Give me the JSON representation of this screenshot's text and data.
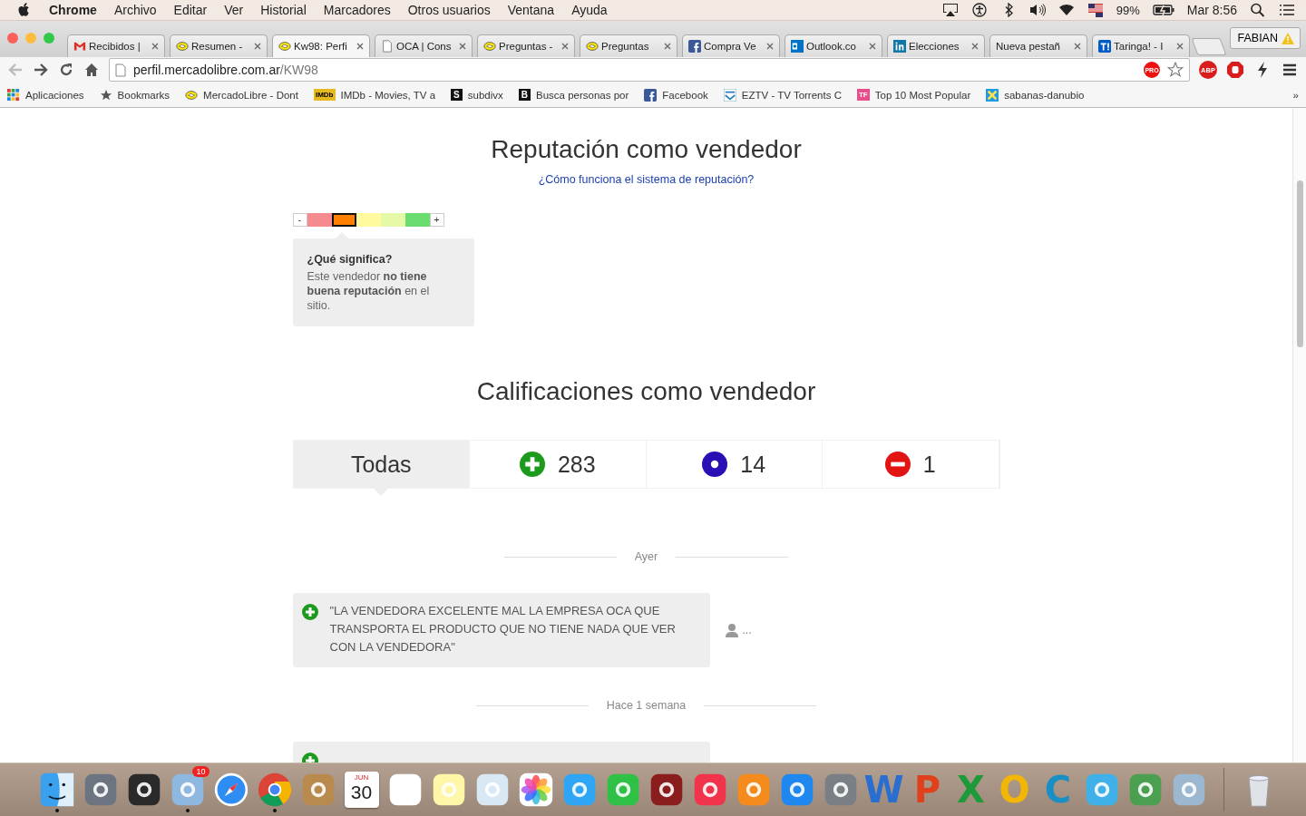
{
  "menu_bar": {
    "app": "Chrome",
    "items": [
      "Archivo",
      "Editar",
      "Ver",
      "Historial",
      "Marcadores",
      "Otros usuarios",
      "Ventana",
      "Ayuda"
    ],
    "battery": "99%",
    "clock": "Mar 8:56"
  },
  "tabs": [
    {
      "label": "Recibidos |",
      "kind": "gmail",
      "selected": false
    },
    {
      "label": "Resumen -",
      "kind": "ml",
      "selected": false
    },
    {
      "label": "Kw98: Perfi",
      "kind": "ml",
      "selected": true
    },
    {
      "label": "OCA | Cons",
      "kind": "page",
      "selected": false
    },
    {
      "label": "Preguntas -",
      "kind": "ml",
      "selected": false
    },
    {
      "label": "Preguntas",
      "kind": "ml",
      "selected": false
    },
    {
      "label": "Compra Ve",
      "kind": "facebook",
      "selected": false
    },
    {
      "label": "Outlook.co",
      "kind": "outlook",
      "selected": false
    },
    {
      "label": "Elecciones",
      "kind": "linkedin",
      "selected": false
    },
    {
      "label": "Nueva pestañ",
      "kind": "none",
      "selected": false
    },
    {
      "label": "Taringa! - I",
      "kind": "taringa",
      "selected": false
    }
  ],
  "profile": "FABIAN",
  "address_bar": {
    "host": "perfil.mercadolibre.com.ar",
    "path": "/KW98"
  },
  "extensions": {
    "pro": "PRO",
    "abp": "ABP"
  },
  "bookmarks": [
    {
      "label": "Aplicaciones",
      "kind": "apps"
    },
    {
      "label": "Bookmarks",
      "kind": "star"
    },
    {
      "label": "MercadoLibre - Dont",
      "kind": "ml"
    },
    {
      "label": "IMDb - Movies, TV a",
      "kind": "imdb",
      "badge": "IMDb"
    },
    {
      "label": "subdivx",
      "kind": "square",
      "badge": "S"
    },
    {
      "label": "Busca personas por",
      "kind": "square",
      "badge": "B"
    },
    {
      "label": "Facebook",
      "kind": "facebook"
    },
    {
      "label": "EZTV - TV Torrents C",
      "kind": "eztv"
    },
    {
      "label": "Top 10 Most Popular",
      "kind": "tf",
      "badge": "TF"
    },
    {
      "label": "sabanas-danubio",
      "kind": "x"
    }
  ],
  "bookmarks_more": "»",
  "reputation": {
    "title": "Reputación como vendedor",
    "link": "¿Cómo funciona el sistema de reputación?",
    "minus": "-",
    "plus": "+",
    "levels": [
      {
        "color": "#f58a8f",
        "selected": false
      },
      {
        "color": "#ff7f00",
        "selected": true
      },
      {
        "color": "#fffa9e",
        "selected": false
      },
      {
        "color": "#e6f9a8",
        "selected": false
      },
      {
        "color": "#6bdc6f",
        "selected": false
      }
    ],
    "tooltip_title": "¿Qué significa?",
    "tooltip_text": "Este vendedor **no tiene buena reputación** en el sitio."
  },
  "ratings": {
    "title": "Calificaciones como vendedor",
    "filters": [
      {
        "kind": "all",
        "label": "Todas",
        "selected": true
      },
      {
        "kind": "positive",
        "label": "283",
        "selected": false
      },
      {
        "kind": "neutral",
        "label": "14",
        "selected": false
      },
      {
        "kind": "negative",
        "label": "1",
        "selected": false
      }
    ],
    "groups": [
      {
        "date": "Ayer",
        "reviews": [
          {
            "kind": "positive",
            "text": "\"LA VENDEDORA EXCELENTE MAL LA EMPRESA OCA QUE TRANSPORTA EL PRODUCTO QUE NO TIENE NADA QUE VER CON LA VENDEDORA\"",
            "author": "..."
          }
        ]
      },
      {
        "date": "Hace 1 semana",
        "reviews": [
          {
            "kind": "positive"
          }
        ]
      }
    ]
  },
  "dock": [
    {
      "kind": "finder",
      "running": true
    },
    {
      "kind": "launchpad",
      "running": false
    },
    {
      "kind": "dashboard",
      "running": false
    },
    {
      "kind": "mail",
      "running": true,
      "badge": "10"
    },
    {
      "kind": "safari",
      "running": false
    },
    {
      "kind": "chrome",
      "running": true
    },
    {
      "kind": "contacts",
      "running": false
    },
    {
      "kind": "calendar",
      "running": false,
      "month": "JUN",
      "day": "30"
    },
    {
      "kind": "reminders",
      "running": false
    },
    {
      "kind": "notes",
      "running": false
    },
    {
      "kind": "preview",
      "running": false
    },
    {
      "kind": "photos",
      "running": false
    },
    {
      "kind": "messages",
      "running": false
    },
    {
      "kind": "facetime",
      "running": false
    },
    {
      "kind": "photobooth",
      "running": false
    },
    {
      "kind": "itunes",
      "running": false
    },
    {
      "kind": "ibooks",
      "running": false
    },
    {
      "kind": "appstore",
      "running": false
    },
    {
      "kind": "prefs",
      "running": false
    },
    {
      "kind": "letter",
      "label": "W",
      "color": "#2a6fd0",
      "running": false
    },
    {
      "kind": "letter",
      "label": "P",
      "color": "#e0401c",
      "running": false
    },
    {
      "kind": "letter",
      "label": "X",
      "color": "#1f9a3a",
      "running": false
    },
    {
      "kind": "letter",
      "label": "O",
      "color": "#f2b705",
      "running": false
    },
    {
      "kind": "letter",
      "label": "C",
      "color": "#1a8fc4",
      "running": false
    },
    {
      "kind": "messenger",
      "running": false
    },
    {
      "kind": "globe",
      "running": false
    },
    {
      "kind": "network",
      "running": false
    },
    {
      "kind": "trash",
      "running": false
    }
  ]
}
